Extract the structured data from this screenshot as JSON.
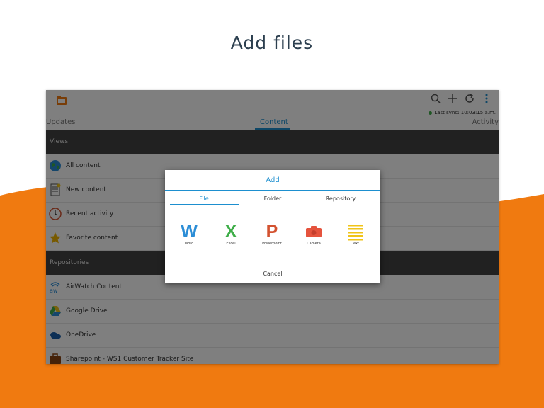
{
  "promo": {
    "title": "Add files"
  },
  "colors": {
    "accent": "#1d8fcf",
    "orange": "#f07a10",
    "header_dark": "#424242"
  },
  "app": {
    "toolbar_icons": [
      "folder-icon",
      "search-icon",
      "add-icon",
      "refresh-icon",
      "more-vertical-icon"
    ],
    "sync_status": "Last sync: 10:03:15 a.m.",
    "tabs": [
      "Updates",
      "Content",
      "Activity"
    ],
    "active_tab": "Content",
    "views_header": "Views",
    "views": [
      {
        "label": "All content",
        "icon": "globe-icon"
      },
      {
        "label": "New content",
        "icon": "document-icon"
      },
      {
        "label": "Recent activity",
        "icon": "clock-icon"
      },
      {
        "label": "Favorite content",
        "icon": "star-icon"
      }
    ],
    "repositories_header": "Repositories",
    "repositories": [
      {
        "label": "AirWatch Content",
        "icon": "airwatch-icon"
      },
      {
        "label": "Google Drive",
        "icon": "google-drive-icon"
      },
      {
        "label": "OneDrive",
        "icon": "onedrive-icon"
      },
      {
        "label": "Sharepoint - WS1 Customer Tracker Site",
        "icon": "briefcase-icon"
      }
    ]
  },
  "dialog": {
    "title": "Add",
    "tabs": [
      "File",
      "Folder",
      "Repository"
    ],
    "active_tab": "File",
    "options": [
      {
        "label": "Word",
        "icon": "word-icon",
        "glyph": "W"
      },
      {
        "label": "Excel",
        "icon": "excel-icon",
        "glyph": "X"
      },
      {
        "label": "Powerpoint",
        "icon": "powerpoint-icon",
        "glyph": "P"
      },
      {
        "label": "Camera",
        "icon": "camera-icon"
      },
      {
        "label": "Text",
        "icon": "text-icon"
      }
    ],
    "cancel_label": "Cancel"
  }
}
